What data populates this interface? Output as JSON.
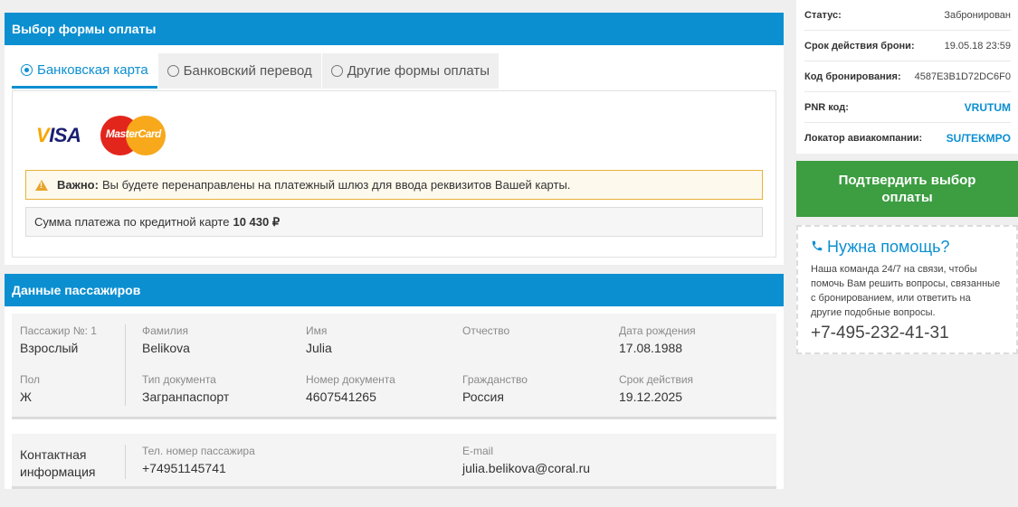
{
  "payment": {
    "header": "Выбор формы оплаты",
    "tabs": [
      {
        "label": "Банковская карта",
        "active": true
      },
      {
        "label": "Банковский перевод",
        "active": false
      },
      {
        "label": "Другие формы оплаты",
        "active": false
      }
    ],
    "logos": {
      "visa": "VISA",
      "mastercard": "MasterCard"
    },
    "notice_bold": "Важно:",
    "notice_text": "Вы будете перенаправлены на платежный шлюз для ввода реквизитов Вашей карты.",
    "sum_label": "Сумма платежа по кредитной карте",
    "sum_value": "10 430  ₽"
  },
  "passengers": {
    "header": "Данные пассажиров",
    "passenger": {
      "number_label": "Пассажир №: 1",
      "type": "Взрослый",
      "gender_label": "Пол",
      "gender": "Ж",
      "surname_label": "Фамилия",
      "surname": "Belikova",
      "name_label": "Имя",
      "name": "Julia",
      "patronymic_label": "Отчество",
      "patronymic": "",
      "birth_label": "Дата рождения",
      "birth": "17.08.1988",
      "doc_type_label": "Тип документа",
      "doc_type": "Загранпаспорт",
      "doc_number_label": "Номер документа",
      "doc_number": "4607541265",
      "citizenship_label": "Гражданство",
      "citizenship": "Россия",
      "validity_label": "Срок действия",
      "validity": "19.12.2025"
    },
    "contact": {
      "title_line1": "Контактная",
      "title_line2": "информация",
      "phone_label": "Тел. номер пассажира",
      "phone": "+74951145741",
      "email_label": "E-mail",
      "email": "julia.belikova@coral.ru"
    }
  },
  "booking": {
    "rows": [
      {
        "key": "Статус:",
        "value": "Забронирован"
      },
      {
        "key": "Срок действия брони:",
        "value": "19.05.18 23:59"
      },
      {
        "key": "Код бронирования:",
        "value": "4587E3B1D72DC6F0"
      },
      {
        "key": "PNR код:",
        "value": "VRUTUM"
      },
      {
        "key": "Локатор авиакомпании:",
        "value": "SU/TEKMPO"
      }
    ],
    "confirm_button": "Подтвердить выбор оплаты"
  },
  "help": {
    "title": "Нужна помощь?",
    "text": "Наша команда 24/7 на связи, чтобы помочь Вам решить вопросы, связанные с бронированием, или ответить на другие подобные вопросы.",
    "phone": "+7-495-232-41-31",
    "icon": "phone-icon"
  },
  "colors": {
    "accent": "#0b8fd1",
    "confirm": "#3c9d41",
    "warning": "#e8b23a"
  }
}
